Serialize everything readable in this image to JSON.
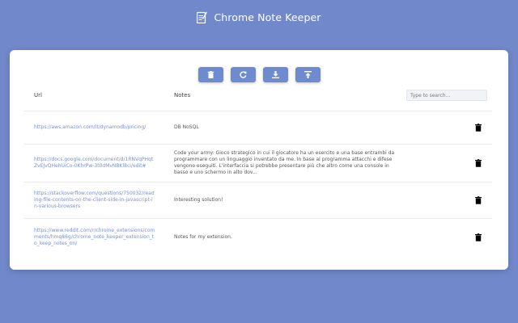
{
  "app": {
    "title": "Chrome Note Keeper"
  },
  "table": {
    "headers": {
      "url": "Url",
      "notes": "Notes"
    },
    "search": {
      "placeholder": "Type to search...",
      "value": ""
    },
    "rows": [
      {
        "url": "https://aws.amazon.com/it/dynamodb/pricing/",
        "note": "DB NoSQL"
      },
      {
        "url": "https://docs.google.com/document/d/1RNVqPHqtZvEJvQHehUiCo-0KhrPw-3t0dMvNBKl8ci/edit#",
        "note": "Code your army: Gioco strategico in cui il giocatore ha un esercito e una base entrambi da programmare con un linguaggio inventato da me. In base al programma attacchi e difese vengono eseguiti. L'interfaccia si potrebbe presentare più che altro come una console in basso e uno schermo in alto dov..."
      },
      {
        "url": "https://stackoverflow.com/questions/750032/reading-file-contents-on-the-client-side-in-javascript-in-various-browsers",
        "note": "Interesting solution!"
      },
      {
        "url": "https://www.reddit.com/r/chrome_extensions/comments/hmq86g/chrome_note_keeper_extension_to_keep_notes_on/",
        "note": "Notes for my extension."
      }
    ]
  },
  "colors": {
    "background": "#7189cb",
    "accent": "#6e8bd0",
    "link": "#7d8ed1"
  }
}
